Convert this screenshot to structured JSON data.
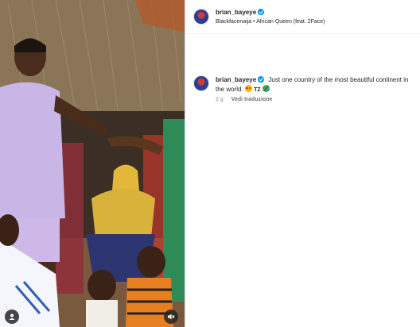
{
  "post": {
    "username": "brian_bayeye",
    "audio": "Blackfacenaija • African Queen (feat. 2Face)",
    "caption_text": "Just one country of the most beautiful continent in the world.",
    "caption_flag_label": "TZ",
    "time_ago": "2 g",
    "translate_label": "Vedi traduzione"
  },
  "icons": {
    "verified": "verified-badge-icon",
    "avatar": "avatar",
    "user_tag": "user-icon",
    "mute": "muted-speaker-icon"
  },
  "colors": {
    "verified_blue": "#0095f6",
    "text_primary": "#262626",
    "text_secondary": "#8e8e8e"
  }
}
